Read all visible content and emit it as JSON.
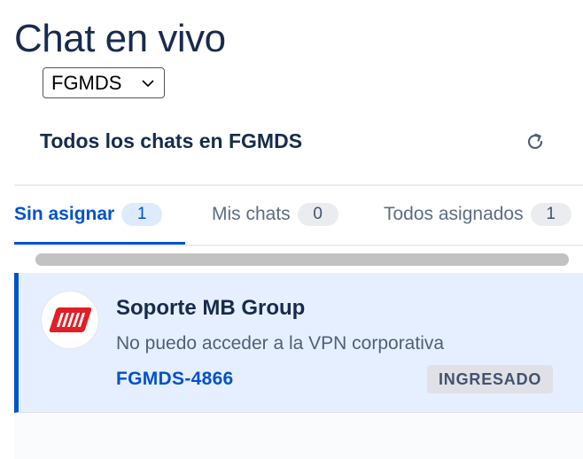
{
  "page": {
    "title": "Chat en vivo"
  },
  "project_select": {
    "selected": "FGMDS"
  },
  "panel": {
    "title": "Todos los chats en FGMDS",
    "refresh_icon": "refresh-icon"
  },
  "tabs": [
    {
      "label": "Sin asignar",
      "count": "1",
      "active": true
    },
    {
      "label": "Mis chats",
      "count": "0",
      "active": false
    },
    {
      "label": "Todos asignados",
      "count": "1",
      "active": false
    }
  ],
  "chats": [
    {
      "name": "Soporte MB Group",
      "preview": "No puedo acceder a la VPN corporativa",
      "key": "FGMDS-4866",
      "status": "INGRESADO",
      "avatar_logo": "MB"
    }
  ],
  "colors": {
    "accent": "#0052cc",
    "selected_row_bg": "#e6efff",
    "logo_red": "#e41e26",
    "text_primary": "#172b4d"
  }
}
